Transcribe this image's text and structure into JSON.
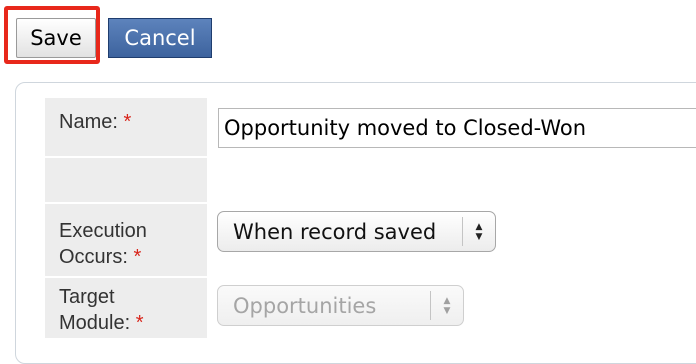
{
  "toolbar": {
    "save_label": "Save",
    "cancel_label": "Cancel"
  },
  "form": {
    "name": {
      "label": "Name:",
      "required_mark": "*",
      "value": "Opportunity moved to Closed-Won"
    },
    "execution": {
      "label_line1": "Execution",
      "label_line2": "Occurs:",
      "required_mark": "*",
      "selected": "When record saved"
    },
    "target": {
      "label_line1": "Target",
      "label_line2": "Module:",
      "required_mark": "*",
      "selected": "Opportunities",
      "disabled": true
    }
  },
  "icons": {
    "select_arrows": "up-down-arrows-icon",
    "up": "▲",
    "down": "▼"
  },
  "colors": {
    "highlight": "#e8281b",
    "cancel_button": "#4a6fa8",
    "required": "#d8241a",
    "label_bg": "#ededed"
  }
}
